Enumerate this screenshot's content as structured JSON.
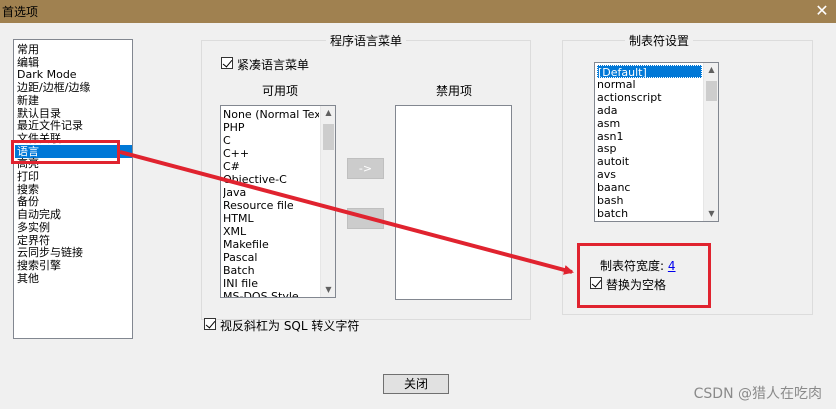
{
  "window": {
    "title": "首选项",
    "close_glyph": "✕"
  },
  "categories": {
    "items": [
      "常用",
      "编辑",
      "Dark Mode",
      "边距/边框/边缘",
      "新建",
      "默认目录",
      "最近文件记录",
      "文件关联",
      "语言",
      "高亮",
      "打印",
      "搜索",
      "备份",
      "自动完成",
      "多实例",
      "定界符",
      "云同步与链接",
      "搜索引擎",
      "其他"
    ],
    "selected_index": 8
  },
  "language_menu": {
    "group_title": "程序语言菜单",
    "compact_label": "紧凑语言菜单",
    "compact_checked": true,
    "available_label": "可用项",
    "disabled_label": "禁用项",
    "available_items": [
      "None (Normal Text)",
      "PHP",
      "C",
      "C++",
      "C#",
      "Objective-C",
      "Java",
      "Resource file",
      "HTML",
      "XML",
      "Makefile",
      "Pascal",
      "Batch",
      "INI file",
      "MS-DOS Style"
    ],
    "move_right_label": "->",
    "move_left_label": "<-"
  },
  "sql_escape": {
    "label": "视反斜杠为 SQL 转义字符",
    "checked": true
  },
  "tab_settings": {
    "group_title": "制表符设置",
    "items": [
      "[Default]",
      "normal",
      "actionscript",
      "ada",
      "asm",
      "asn1",
      "asp",
      "autoit",
      "avs",
      "baanc",
      "bash",
      "batch"
    ],
    "selected_index": 0,
    "tab_width_label": "制表符宽度:",
    "tab_width_value": "4",
    "replace_label": "替换为空格",
    "replace_checked": true
  },
  "close_button_label": "关闭",
  "annotation": {
    "color": "#e0232f"
  },
  "watermark": "CSDN @猎人在吃肉"
}
